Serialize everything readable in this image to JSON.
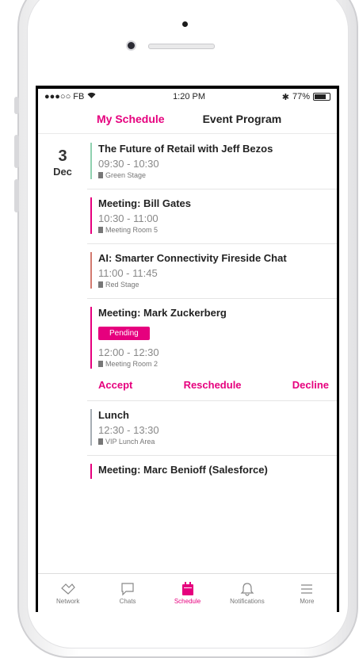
{
  "status": {
    "carrier": "●●●○○ FB",
    "time": "1:20 PM",
    "battery": "77%",
    "bluetooth": "✱"
  },
  "tabs": [
    {
      "label": "My Schedule",
      "active": true
    },
    {
      "label": "Event Program",
      "active": false
    }
  ],
  "date": {
    "day": "3",
    "month": "Dec"
  },
  "events": [
    {
      "title": "The Future of Retail with Jeff Bezos",
      "time": "09:30 - 10:30",
      "location": "Green Stage",
      "color": "#8fd1b0"
    },
    {
      "title": "Meeting: Bill Gates",
      "time": "10:30 - 11:00",
      "location": "Meeting Room 5",
      "color": "#e6007e"
    },
    {
      "title": "AI: Smarter Connectivity Fireside Chat",
      "time": "11:00 - 11:45",
      "location": "Red Stage",
      "color": "#d37a6f"
    },
    {
      "title": "Meeting: Mark Zuckerberg",
      "badge": "Pending",
      "time": "12:00 - 12:30",
      "location": "Meeting Room 2",
      "color": "#e6007e",
      "actions": [
        "Accept",
        "Reschedule",
        "Decline"
      ]
    },
    {
      "title": "Lunch",
      "time": "12:30 - 13:30",
      "location": "VIP Lunch Area",
      "color": "#a6adb4"
    },
    {
      "title": "Meeting: Marc Benioff (Salesforce)",
      "time": "",
      "location": "",
      "color": "#e6007e"
    }
  ],
  "bottom_nav": [
    {
      "label": "Network",
      "icon": "handshake-icon",
      "active": false
    },
    {
      "label": "Chats",
      "icon": "chat-icon",
      "active": false
    },
    {
      "label": "Schedule",
      "icon": "calendar-icon",
      "active": true
    },
    {
      "label": "Notifications",
      "icon": "bell-icon",
      "active": false
    },
    {
      "label": "More",
      "icon": "menu-icon",
      "active": false
    }
  ],
  "colors": {
    "accent": "#e6007e"
  }
}
